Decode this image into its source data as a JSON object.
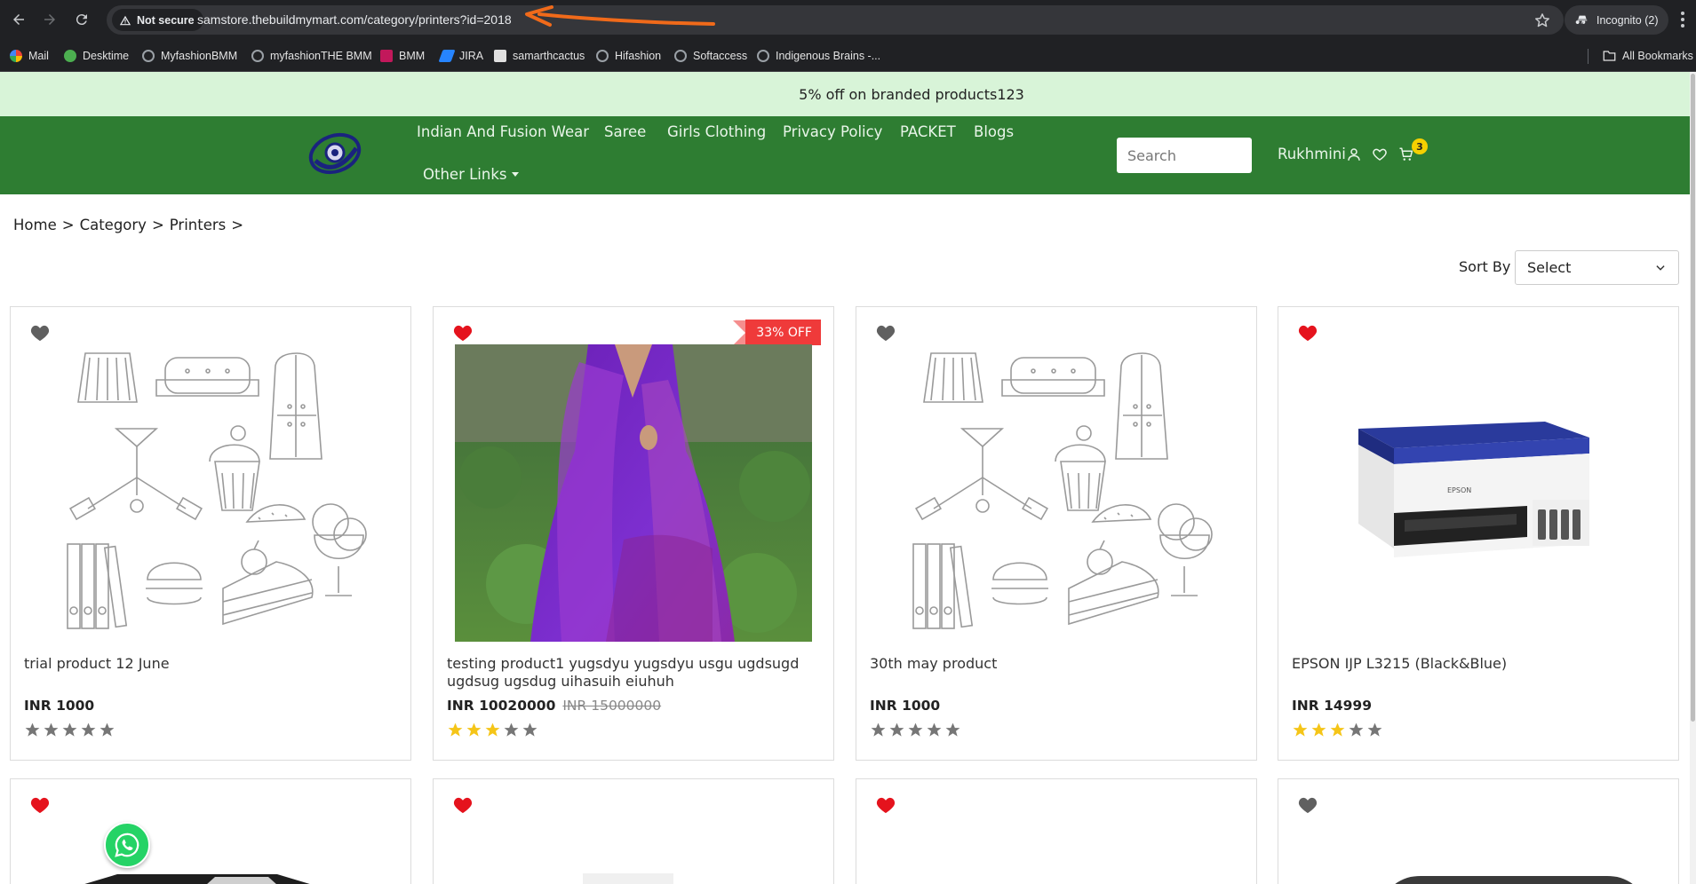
{
  "browser": {
    "security_label": "Not secure",
    "url": "samstore.thebuildmymart.com/category/printers?id=2018",
    "incognito_label": "Incognito (2)",
    "bookmarks": [
      {
        "label": "Mail",
        "color": "#ea4335"
      },
      {
        "label": "Desktime",
        "color": "#4caf50"
      },
      {
        "label": "MyfashionBMM",
        "color": "#9aa0a6"
      },
      {
        "label": "myfashionTHE BMM",
        "color": "#9aa0a6"
      },
      {
        "label": "BMM",
        "color": "#c2185b"
      },
      {
        "label": "JIRA",
        "color": "#2684ff"
      },
      {
        "label": "samarthcactus",
        "color": "#e0e0e0"
      },
      {
        "label": "Hifashion",
        "color": "#9aa0a6"
      },
      {
        "label": "Softaccess",
        "color": "#9aa0a6"
      },
      {
        "label": "Indigenous Brains -...",
        "color": "#9aa0a6"
      }
    ],
    "all_bookmarks_label": "All Bookmarks"
  },
  "promo": {
    "text": "5% off on branded products123"
  },
  "header": {
    "nav": [
      "Indian And Fusion Wear",
      "Saree",
      "Girls Clothing",
      "Privacy Policy",
      "PACKET",
      "Blogs"
    ],
    "more_label": "Other Links",
    "search_placeholder": "Search",
    "user_name": "Rukhmini",
    "cart_count": "3",
    "brand_color": "#2e7d32"
  },
  "breadcrumb": {
    "items": [
      "Home",
      ">",
      "Category",
      ">",
      "Printers",
      ">"
    ]
  },
  "sort": {
    "label": "Sort By",
    "selected": "Select"
  },
  "products": [
    {
      "title": "trial product 12 June",
      "price": "INR 1000",
      "old_price": "",
      "rating": 0,
      "favorited": false,
      "image": "placeholder-sketch-icon",
      "discount": ""
    },
    {
      "title": "testing product1 yugsdyu yugsdyu usgu ugdsugd ugdsug ugsdug uihasuih eiuhuh",
      "price": "INR 10020000",
      "old_price": "INR 15000000",
      "rating": 3,
      "favorited": true,
      "image": "purple-dress-photo",
      "discount": "33% OFF"
    },
    {
      "title": "30th may product",
      "price": "INR 1000",
      "old_price": "",
      "rating": 0,
      "favorited": false,
      "image": "placeholder-sketch-icon",
      "discount": ""
    },
    {
      "title": "EPSON IJP L3215 (Black&Blue)",
      "price": "INR 14999",
      "old_price": "",
      "rating": 3,
      "favorited": true,
      "image": "printer-photo",
      "discount": "",
      "printed_brand": "EPSON"
    }
  ],
  "products_row2": [
    {
      "favorited": true
    },
    {
      "favorited": true
    },
    {
      "favorited": true
    },
    {
      "favorited": false
    }
  ],
  "colors": {
    "accent_green": "#2e7d32",
    "promo_bg": "#d8f4d8",
    "heart_red": "#e5131d",
    "star_gold": "#f5c518",
    "discount_red": "#ef3a3a"
  }
}
